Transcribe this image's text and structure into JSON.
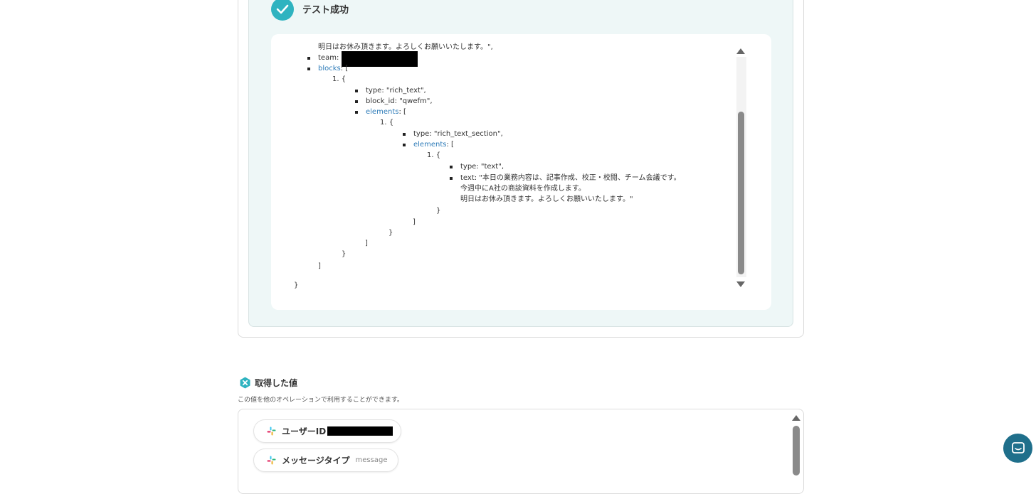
{
  "test_result": {
    "title": "テスト成功",
    "lines": {
      "l1": "明日はお休み頂きます。よろしくお願いいたします。\",",
      "team": "team: ",
      "blocks_key": "blocks",
      "blocks_rest": ": [",
      "item1": "1. {",
      "type1": "type: \"rich_text\",",
      "block_id": "block_id: \"qwefm\",",
      "elements_key": "elements",
      "elements_rest": ": [",
      "item2": "1. {",
      "type2": "type: \"rich_text_section\",",
      "elements_key2": "elements",
      "elements_rest2": ": [",
      "item3": "1. {",
      "type3": "type: \"text\",",
      "text_l1": "text: \"本日の業務内容は、記事作成、校正・校閲、チーム会議です。",
      "text_l2": "今週中にA社の商談資料を作成します。",
      "text_l3": "明日はお休み頂きます。よろしくお願いいたします。\"",
      "c1": "}",
      "c2": "]",
      "c3": "}",
      "c4": "]",
      "c5": "}",
      "c6": "]",
      "c7": "}"
    }
  },
  "obtained_values": {
    "title": "取得した値",
    "subtitle": "この値を他のオペレーションで利用することができます。",
    "items": [
      {
        "label": "ユーザーID",
        "sub": ""
      },
      {
        "label": "メッセージタイプ",
        "sub": "message"
      }
    ]
  },
  "colors": {
    "accent": "#2fb3c0",
    "key_blue": "#2d7bb8",
    "chat_button": "#1f6f8b"
  },
  "icons": {
    "check": "check-icon",
    "slack": "slack-icon",
    "variable": "variable-hexagon-icon",
    "chat": "chat-icon"
  }
}
